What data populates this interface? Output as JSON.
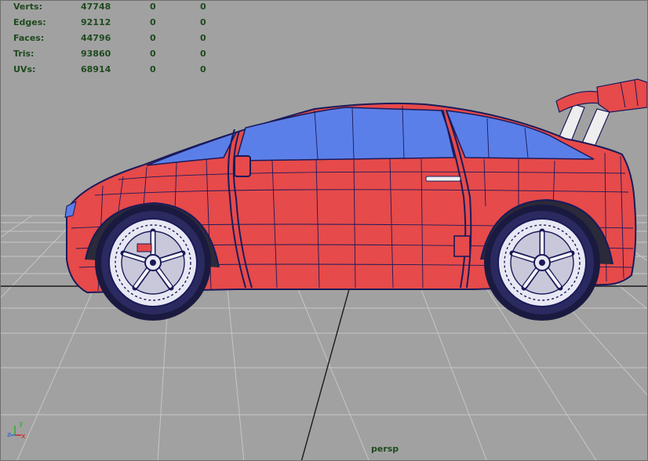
{
  "heads_up": {
    "rows": [
      {
        "label": "Verts:",
        "values": [
          "47748",
          "0",
          "0"
        ]
      },
      {
        "label": "Edges:",
        "values": [
          "92112",
          "0",
          "0"
        ]
      },
      {
        "label": "Faces:",
        "values": [
          "44796",
          "0",
          "0"
        ]
      },
      {
        "label": "Tris:",
        "values": [
          "93860",
          "0",
          "0"
        ]
      },
      {
        "label": "UVs:",
        "values": [
          "68914",
          "0",
          "0"
        ]
      }
    ]
  },
  "viewport": {
    "camera_label": "persp",
    "background_color": "#a1a1a1",
    "grid_color": "#c4c4c4",
    "wire_color": "#1a1a5a",
    "body_color": "#e64a4a",
    "glass_color": "#5b7fe8"
  },
  "axis_gizmo": {
    "x": "x",
    "y": "y",
    "z": "z"
  }
}
